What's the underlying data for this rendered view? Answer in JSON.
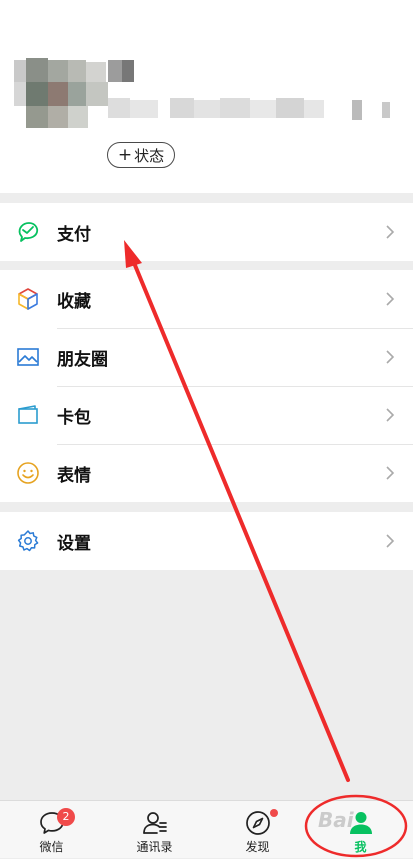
{
  "profile": {
    "status_button": {
      "plus": "+",
      "label": "状态"
    }
  },
  "menu": {
    "pay": {
      "label": "支付",
      "icon": "wechat-pay-icon"
    },
    "favorites": {
      "label": "收藏",
      "icon": "cube-icon"
    },
    "moments": {
      "label": "朋友圈",
      "icon": "image-icon"
    },
    "cards": {
      "label": "卡包",
      "icon": "wallet-icon"
    },
    "stickers": {
      "label": "表情",
      "icon": "smiley-icon"
    },
    "settings": {
      "label": "设置",
      "icon": "gear-icon"
    }
  },
  "tabbar": {
    "chats": {
      "label": "微信",
      "badge": "2",
      "icon": "chat-bubble-icon"
    },
    "contacts": {
      "label": "通讯录",
      "icon": "contacts-icon"
    },
    "discover": {
      "label": "发现",
      "icon": "compass-icon"
    },
    "me": {
      "label": "我",
      "icon": "person-icon",
      "active": true
    }
  },
  "colors": {
    "accent_green": "#07c160",
    "badge_red": "#f04a4a",
    "annotation_red": "#ee2b2b",
    "background": "#ededed"
  }
}
